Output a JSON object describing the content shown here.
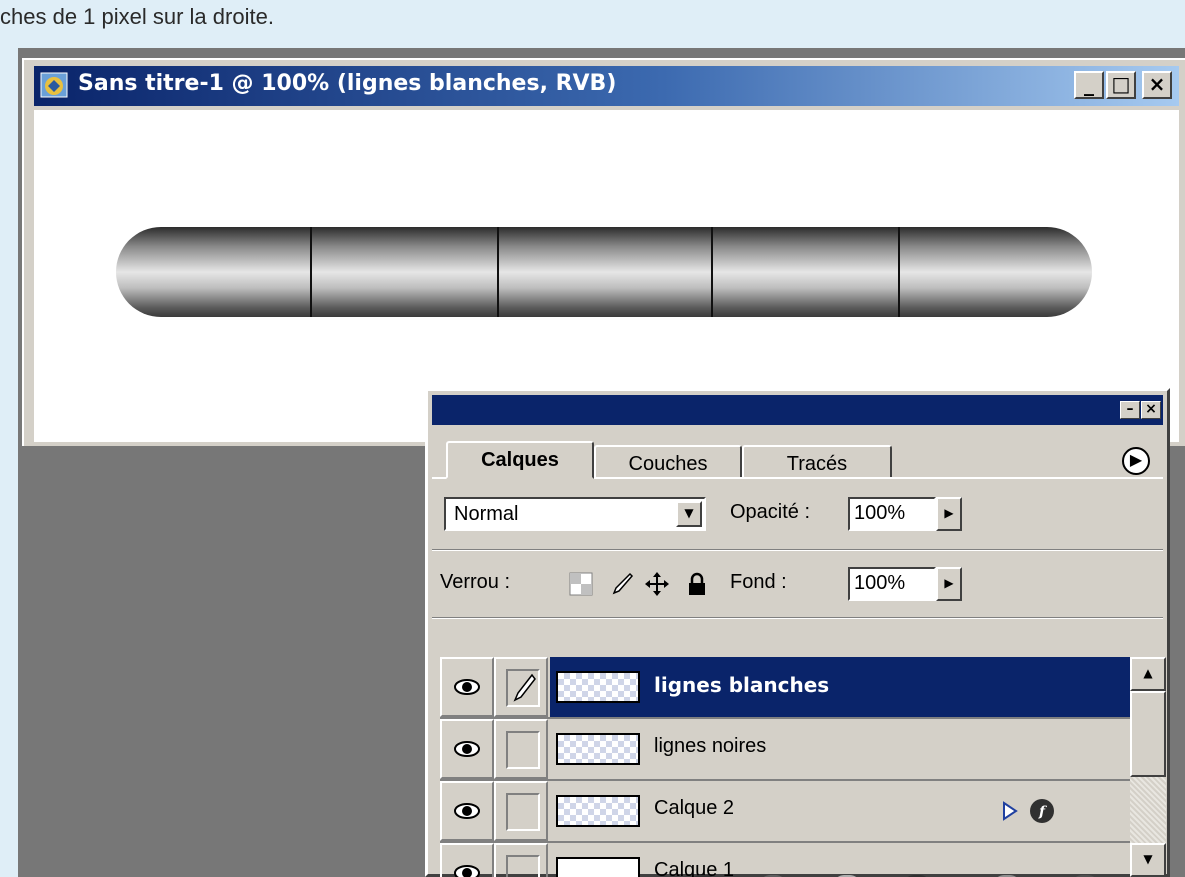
{
  "caption": "ches de 1 pixel sur la droite.",
  "document": {
    "title": "Sans titre-1 @ 100% (lignes blanches, RVB)",
    "buttons": {
      "minimize": "_",
      "maximize": "□",
      "close": "×"
    }
  },
  "layers_palette": {
    "tabs": [
      {
        "label": "Calques",
        "active": true
      },
      {
        "label": "Couches",
        "active": false
      },
      {
        "label": "Tracés",
        "active": false
      }
    ],
    "blend_mode": "Normal",
    "opacity_label": "Opacité :",
    "opacity_value": "100%",
    "lock_label": "Verrou :",
    "fill_label": "Fond :",
    "fill_value": "100%",
    "layers": [
      {
        "name": "lignes blanches",
        "selected": true,
        "visible": true,
        "thumb": "transparent"
      },
      {
        "name": "lignes noires",
        "selected": false,
        "visible": true,
        "thumb": "transparent"
      },
      {
        "name": "Calque 2",
        "selected": false,
        "visible": true,
        "thumb": "transparent",
        "has_effects": true
      },
      {
        "name": "Calque 1",
        "selected": false,
        "visible": true,
        "thumb": "white"
      }
    ],
    "footer_icons": [
      "layer-style-icon",
      "mask-icon",
      "new-set-icon",
      "adjustment-layer-icon",
      "new-layer-icon",
      "trash-icon"
    ]
  },
  "colors": {
    "title_blue": "#0a246a",
    "panel_gray": "#d4d0c8",
    "workspace_gray": "#777777"
  }
}
